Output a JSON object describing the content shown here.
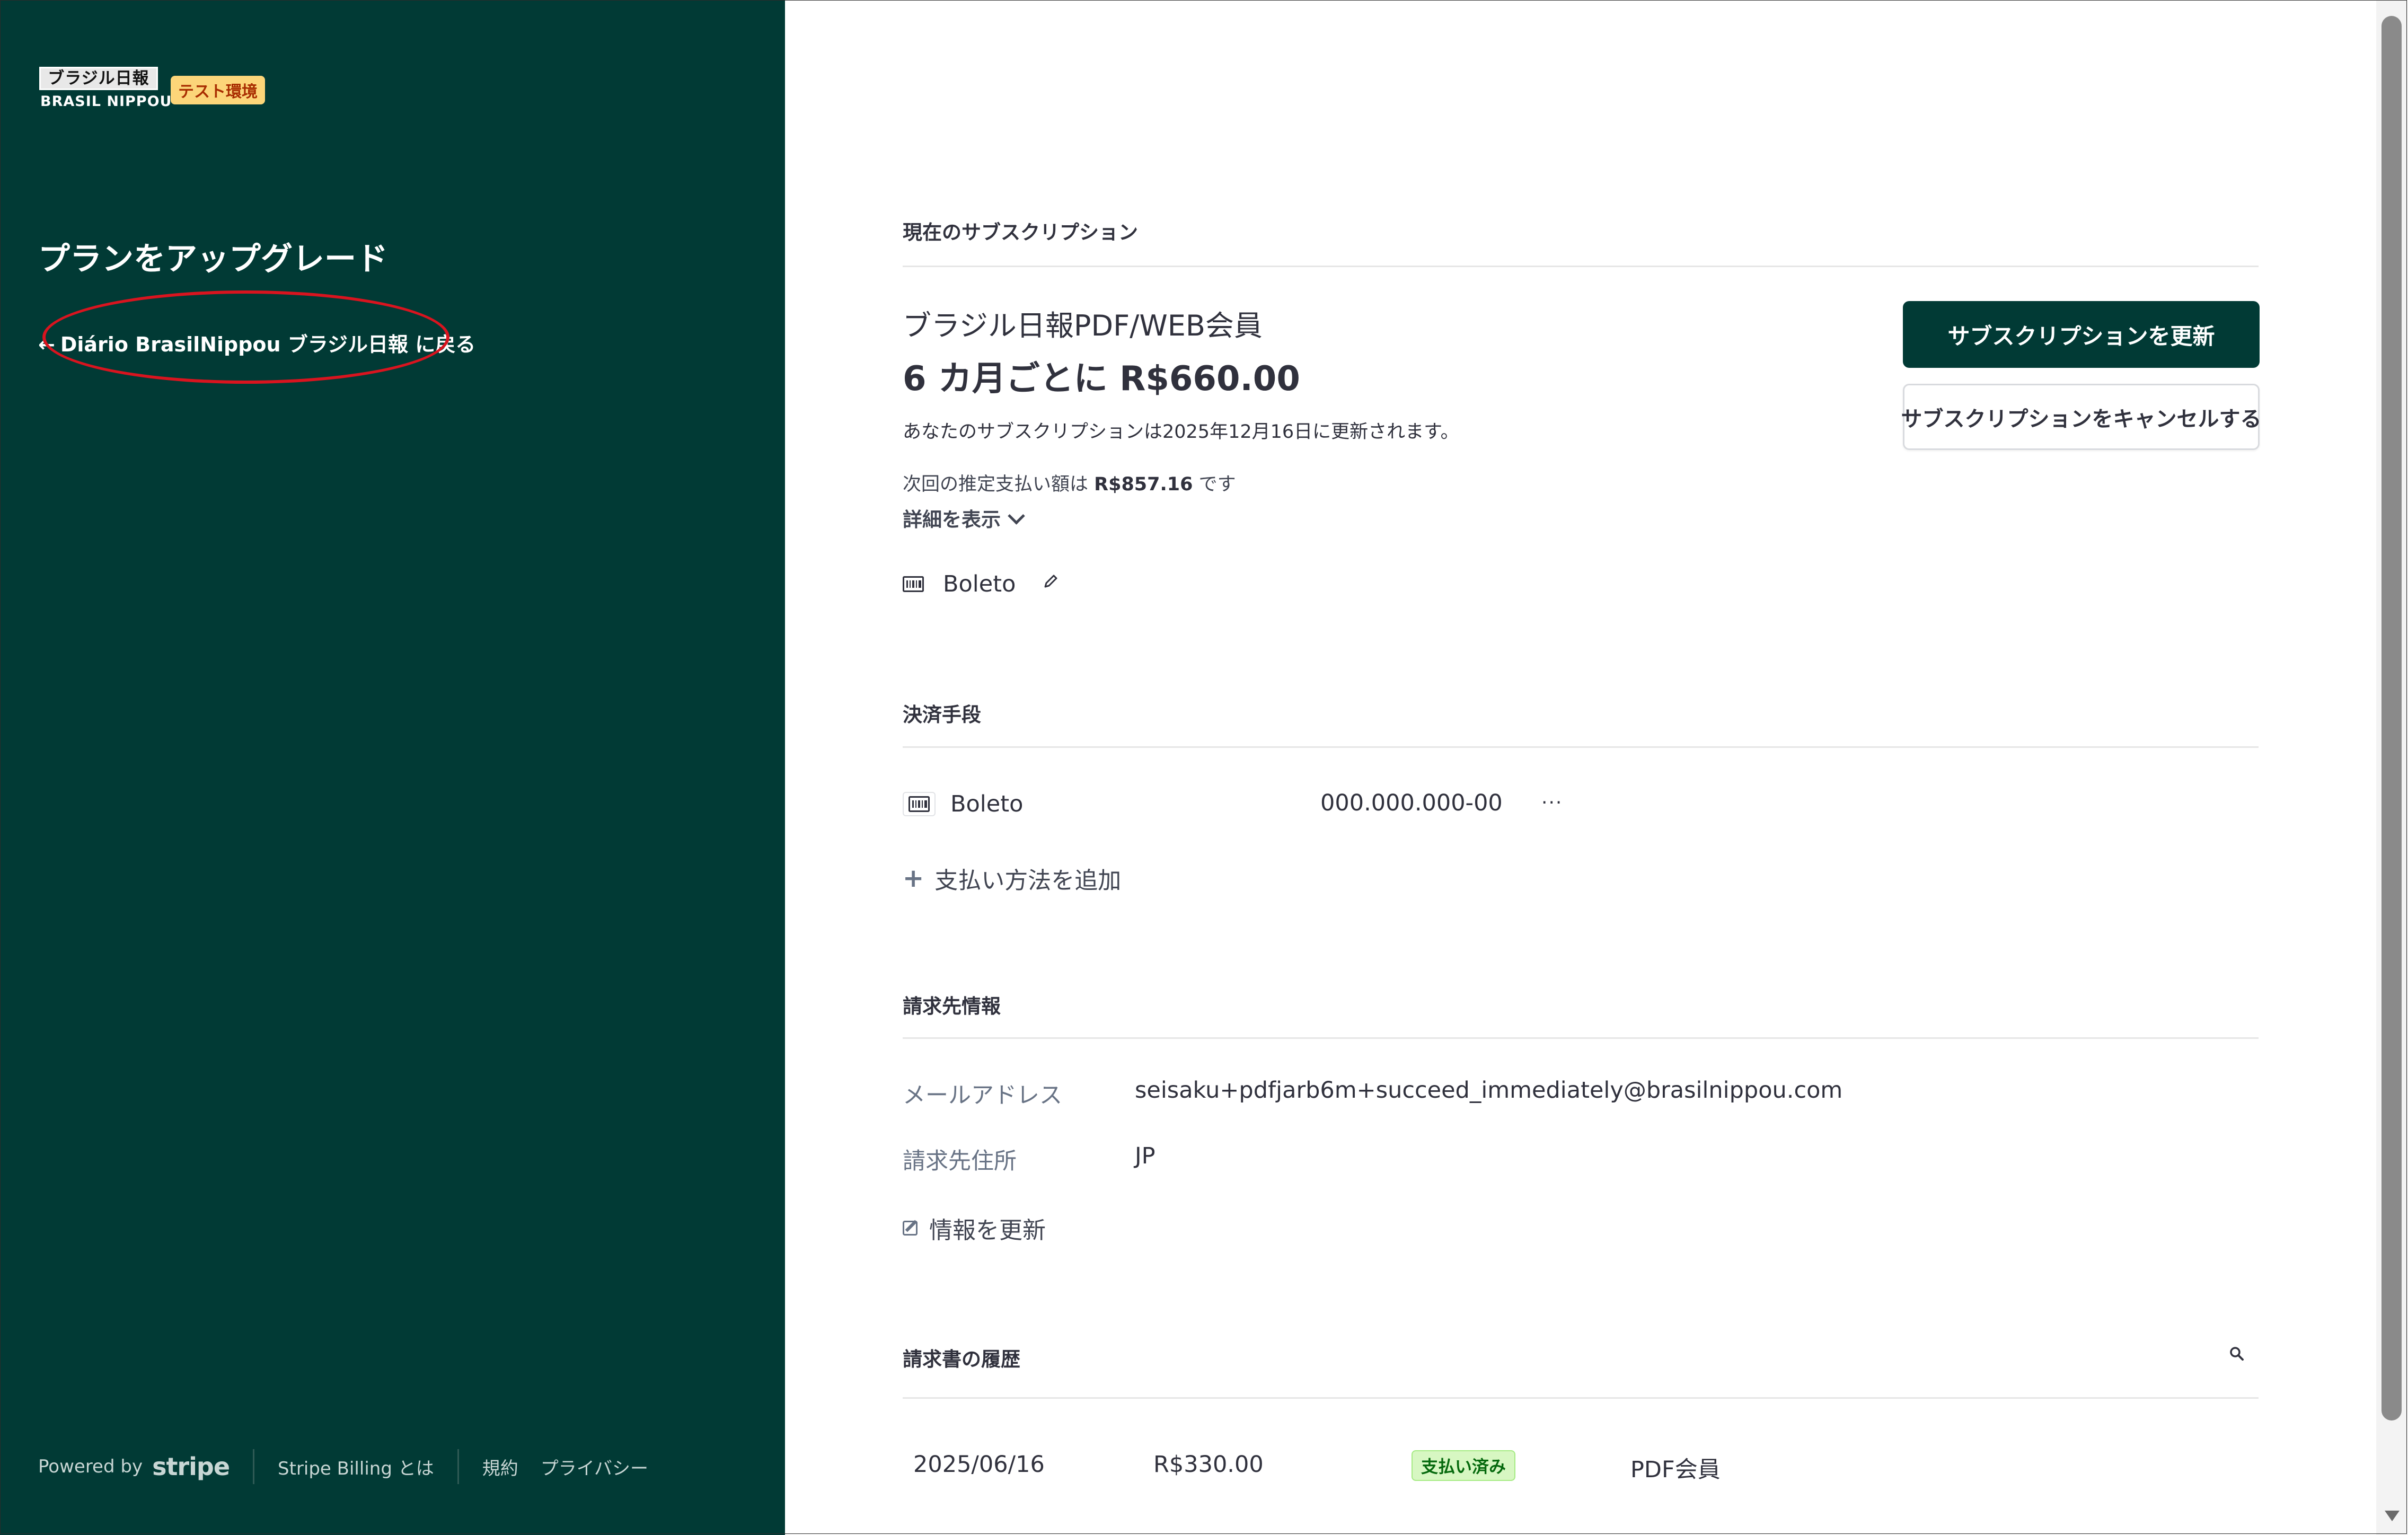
{
  "left_panel": {
    "logo_text_jp": "ブラジル日報",
    "logo_text_en": "BRASIL NIPPOU",
    "test_badge": "テスト環境",
    "title": "プランをアップグレード",
    "back_arrow": "←",
    "back_link": "Diário BrasilNippou ブラジル日報 に戻る",
    "footer": {
      "powered_by": "Powered by",
      "stripe": "stripe",
      "billing_link": "Stripe Billing とは",
      "terms_link": "規約",
      "privacy_link": "プライバシー"
    }
  },
  "subscription": {
    "section_label": "現在のサブスクリプション",
    "plan_name": "ブラジル日報PDF/WEB会員",
    "price": "6 カ月ごとに R$660.00",
    "renew_text": "あなたのサブスクリプションは2025年12月16日に更新されます。",
    "next_payment_prefix": "次回の推定支払い額は ",
    "next_payment_amount": "R$857.16",
    "next_payment_suffix": " です",
    "show_details": "詳細を表示",
    "payment_method": "Boleto",
    "update_button": "サブスクリプションを更新",
    "cancel_button": "サブスクリプションをキャンセルする"
  },
  "payment_methods": {
    "section_label": "決済手段",
    "items": [
      {
        "name": "Boleto",
        "tax_id": "000.000.000-00",
        "more": "···"
      }
    ],
    "add_label": "支払い方法を追加"
  },
  "billing_info": {
    "section_label": "請求先情報",
    "email_label": "メールアドレス",
    "email_value": "seisaku+pdfjarb6m+succeed_immediately@brasilnippou.com",
    "address_label": "請求先住所",
    "address_value": "JP",
    "update_label": "情報を更新"
  },
  "invoice_history": {
    "section_label": "請求書の履歴",
    "rows": [
      {
        "date": "2025/06/16",
        "amount": "R$330.00",
        "status": "支払い済み",
        "description": "PDF会員"
      }
    ]
  },
  "colors": {
    "brand_dark": "#013a35",
    "paid_badge_bg": "#d7f7c2",
    "annotation_red": "#d9141f"
  }
}
